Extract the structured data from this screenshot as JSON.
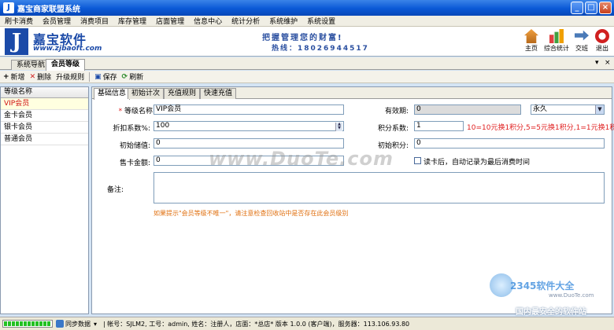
{
  "window": {
    "title": "嘉宝商家联盟系统",
    "app_icon": "J"
  },
  "menu": [
    "刷卡消费",
    "会员管理",
    "消费项目",
    "库存管理",
    "店面管理",
    "信息中心",
    "统计分析",
    "系统维护",
    "系统设置"
  ],
  "banner": {
    "logo_letter": "J",
    "logo_name": "嘉宝软件",
    "logo_url": "www.zjbaoft.com",
    "slogan": "把握管理您的财富!",
    "hotline": "热线：18026944517",
    "tools": [
      {
        "label": "主页",
        "icon": "home-icon"
      },
      {
        "label": "综合统计",
        "icon": "stats-icon"
      },
      {
        "label": "交班",
        "icon": "shift-icon"
      },
      {
        "label": "退出",
        "icon": "exit-icon"
      }
    ]
  },
  "nav_tabs": {
    "items": [
      "系统导航",
      "会员等级"
    ],
    "active": "会员等级",
    "pin": "▾",
    "close": "×"
  },
  "toolbar": {
    "new": "新增",
    "delete": "删除",
    "upgrade": "升级规则",
    "save": "保存",
    "refresh": "刷新"
  },
  "level_list": {
    "header": "等级名称",
    "items": [
      "VIP会员",
      "金卡会员",
      "银卡会员",
      "普通会员"
    ],
    "selected": "VIP会员"
  },
  "sub_tabs": {
    "items": [
      "基础信息",
      "初始计次",
      "充值规则",
      "快速充值"
    ],
    "active": "基础信息"
  },
  "form": {
    "level_name_label": "等级名称:",
    "level_name_value": "VIP会员",
    "discount_label": "折扣系数%:",
    "discount_value": "100",
    "init_value_label": "初始储值:",
    "init_value_value": "0",
    "card_fee_label": "售卡金额:",
    "card_fee_value": "0",
    "validity_label": "有效期:",
    "validity_value": "0",
    "validity_unit": "永久",
    "points_ratio_label": "积分系数:",
    "points_ratio_value": "1",
    "points_ratio_hint": "10=10元换1积分,5=5元换1积分,1=1元换1积",
    "init_points_label": "初始积分:",
    "init_points_value": "0",
    "read_card_label": "读卡后，自动记录为最后消费时间",
    "remark_label": "备注:",
    "remark_value": "",
    "bottom_hint": "如果提示\"会员等级不唯一\"，请注意检查回收站中是否存在此会员级别"
  },
  "watermark": {
    "main": "www.DuoTe.com",
    "site": "2345软件大全",
    "url": "www.DuoTe.com",
    "tag": "国内最安全的软件站"
  },
  "status": {
    "sync": "同步数据",
    "info": "| 帐号：SJLM2, 工号：admin, 姓名：注册人，店面：*总店*   版本 1.0.0 (客户端)，服务器：113.106.93.80"
  },
  "colors": {
    "title_bar": "#0a58d6",
    "selected_row": "#d01010",
    "hint_red": "#e02020",
    "hint_orange": "#e07010"
  }
}
